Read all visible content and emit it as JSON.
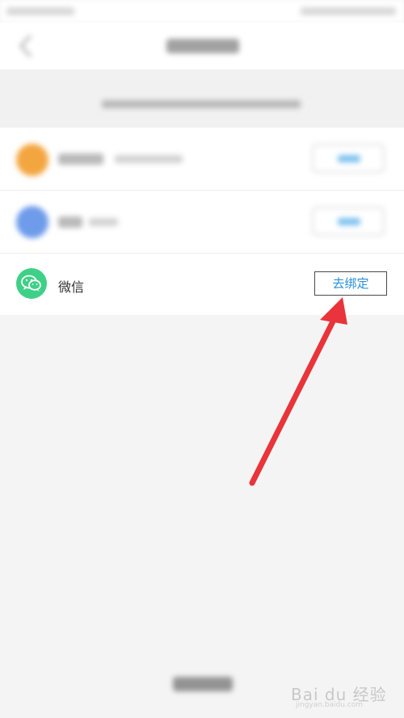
{
  "status_bar": {
    "left_text": "",
    "right_text": ""
  },
  "nav": {
    "title": ""
  },
  "hint": {
    "text": ""
  },
  "accounts": [
    {
      "name": "",
      "detail": "",
      "action_label": "",
      "avatar_color": "#f3a640"
    },
    {
      "name": "",
      "detail": "",
      "action_label": "",
      "avatar_color": "#6e9bea"
    },
    {
      "name": "微信",
      "action_label": "去绑定",
      "avatar_color": "#3fd087",
      "icon": "wechat-icon"
    }
  ],
  "footer": {
    "link_label": ""
  },
  "annotation": {
    "arrow_color": "#e8343a"
  },
  "watermark": {
    "text": "Bai du 经验",
    "sub": "jingyan.baidu.com"
  }
}
